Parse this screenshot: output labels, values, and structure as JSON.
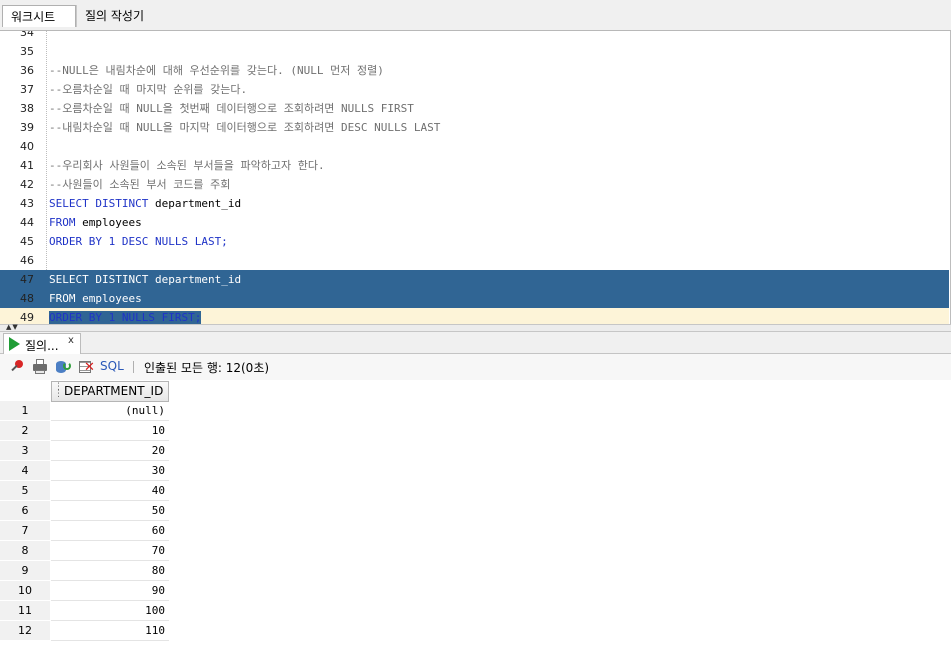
{
  "tabs": {
    "worksheet": "워크시트",
    "query_builder": "질의 작성기"
  },
  "editor": {
    "lines": [
      {
        "num": "34",
        "cls": "plain",
        "segs": []
      },
      {
        "num": "35",
        "cls": "plain",
        "segs": []
      },
      {
        "num": "36",
        "cls": "cmt",
        "segs": [
          {
            "t": "--NULL은 내림차순에 대해 우선순위를 갖는다. (NULL 먼저 정렬)",
            "k": 0
          }
        ]
      },
      {
        "num": "37",
        "cls": "cmt",
        "segs": [
          {
            "t": "--오름차순일 때 마지막 순위를 갖는다.",
            "k": 0
          }
        ]
      },
      {
        "num": "38",
        "cls": "cmt",
        "segs": [
          {
            "t": "--오름차순일 때 NULL을 첫번째 데이터행으로 조회하려면 NULLS FIRST",
            "k": 0
          }
        ]
      },
      {
        "num": "39",
        "cls": "cmt",
        "segs": [
          {
            "t": "--내림차순일 때 NULL을 마지막 데이터행으로 조회하려면 DESC NULLS LAST",
            "k": 0
          }
        ]
      },
      {
        "num": "40",
        "cls": "plain",
        "segs": []
      },
      {
        "num": "41",
        "cls": "cmt",
        "segs": [
          {
            "t": "--우리회사 사원들이 소속된 부서들을 파악하고자 한다.",
            "k": 0
          }
        ]
      },
      {
        "num": "42",
        "cls": "cmt",
        "segs": [
          {
            "t": "--사원들이 소속된 부서 코드를 주회",
            "k": 0
          }
        ]
      },
      {
        "num": "43",
        "cls": "plain",
        "segs": [
          {
            "t": "SELECT DISTINCT ",
            "k": 1
          },
          {
            "t": "department_id",
            "k": 0
          }
        ]
      },
      {
        "num": "44",
        "cls": "plain",
        "segs": [
          {
            "t": "FROM ",
            "k": 1
          },
          {
            "t": "employees",
            "k": 0
          }
        ]
      },
      {
        "num": "45",
        "cls": "plain",
        "segs": [
          {
            "t": "ORDER BY 1 DESC NULLS LAST;",
            "k": 1
          }
        ]
      },
      {
        "num": "46",
        "cls": "plain",
        "segs": []
      },
      {
        "num": "47",
        "cls": "sel",
        "segs": [
          {
            "t": "SELECT DISTINCT ",
            "k": 1
          },
          {
            "t": "department_id",
            "k": 0
          }
        ]
      },
      {
        "num": "48",
        "cls": "sel",
        "segs": [
          {
            "t": "FROM ",
            "k": 1
          },
          {
            "t": "employees",
            "k": 0
          }
        ]
      },
      {
        "num": "49",
        "cls": "cur",
        "segs": [
          {
            "t": "ORDER BY 1 NULLS FIRST;",
            "k": 1
          }
        ]
      }
    ]
  },
  "results": {
    "tab_label": "질의...",
    "tab_close": "x",
    "toolbar": {
      "sql_label": "SQL",
      "separator": "|",
      "status": "인출된 모든 행: 12(0초)"
    },
    "column_header": "DEPARTMENT_ID",
    "rows": [
      {
        "n": "1",
        "v": "(null)"
      },
      {
        "n": "2",
        "v": "10"
      },
      {
        "n": "3",
        "v": "20"
      },
      {
        "n": "4",
        "v": "30"
      },
      {
        "n": "5",
        "v": "40"
      },
      {
        "n": "6",
        "v": "50"
      },
      {
        "n": "7",
        "v": "60"
      },
      {
        "n": "8",
        "v": "70"
      },
      {
        "n": "9",
        "v": "80"
      },
      {
        "n": "10",
        "v": "90"
      },
      {
        "n": "11",
        "v": "100"
      },
      {
        "n": "12",
        "v": "110"
      }
    ]
  },
  "colors": {
    "selection": "#306594",
    "keyword": "#1f33c7",
    "comment": "#6f6f6f",
    "current_line": "#fdf4d8"
  }
}
